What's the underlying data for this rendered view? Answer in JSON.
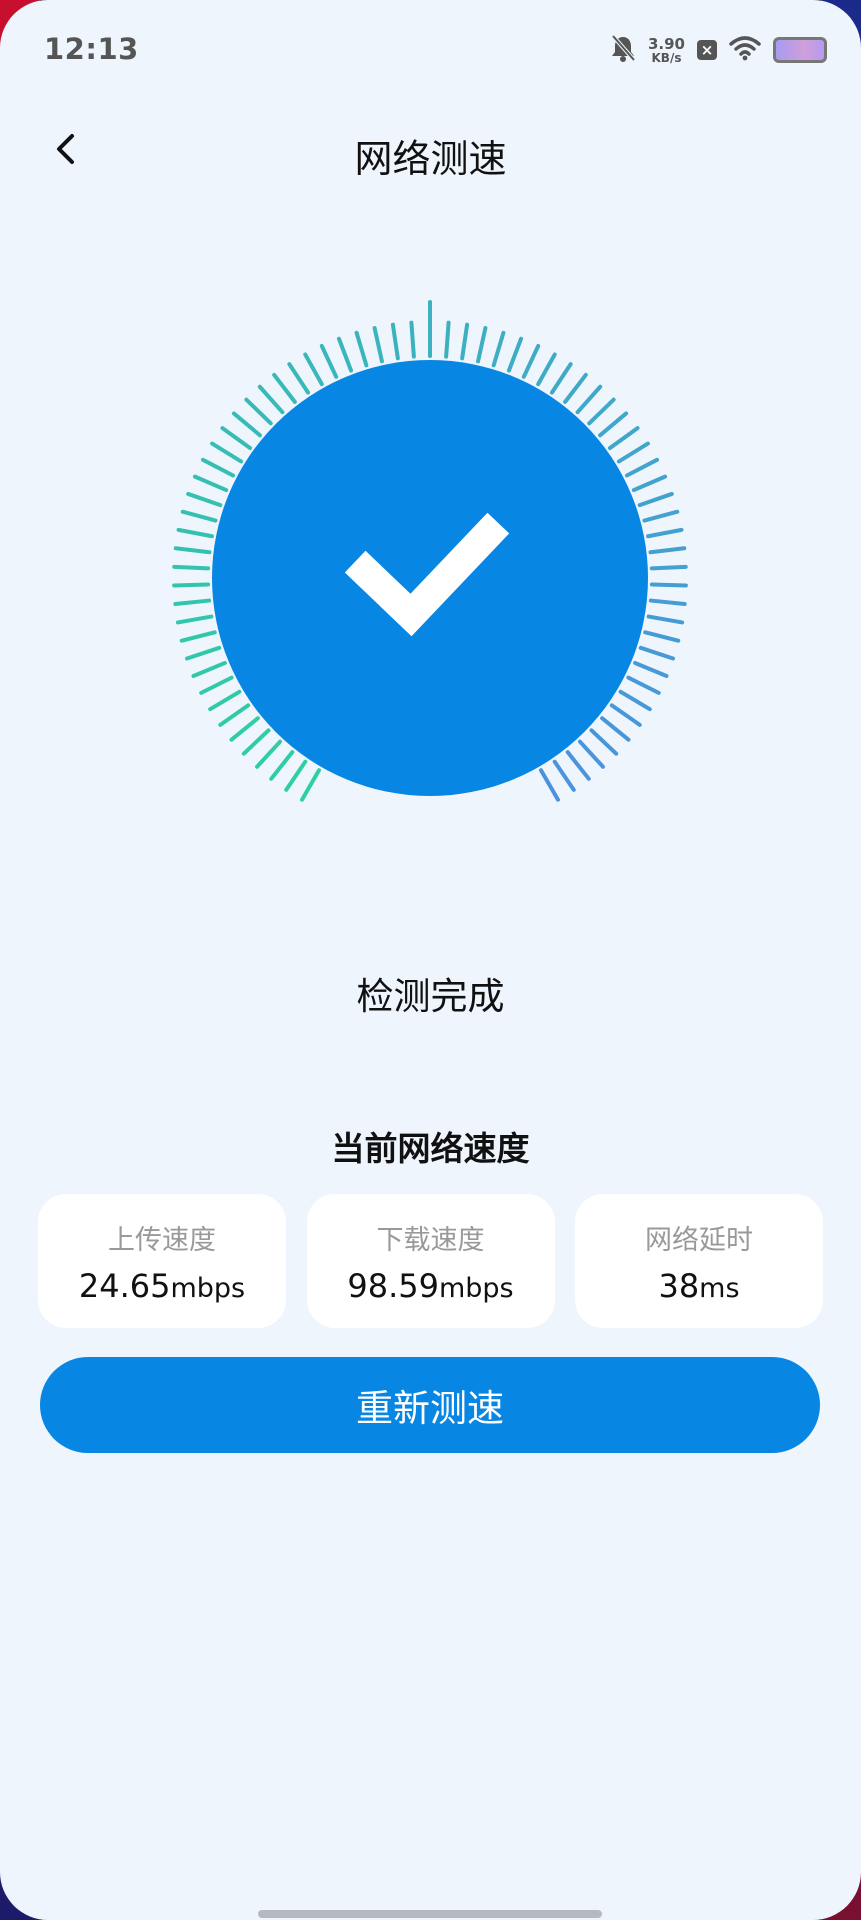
{
  "status_bar": {
    "time": "12:13",
    "net_speed_value": "3.90",
    "net_speed_unit": "KB/s",
    "badge": "×"
  },
  "header": {
    "title": "网络测速"
  },
  "gauge": {
    "state": "complete",
    "progress": 1.0,
    "colors": {
      "circle": "#0786e3",
      "tick_start": "#2dd0a2",
      "tick_end": "#4a92de"
    }
  },
  "result": {
    "status": "检测完成",
    "section_title": "当前网络速度",
    "stats": [
      {
        "label": "上传速度",
        "value": "24.65",
        "unit": "mbps"
      },
      {
        "label": "下载速度",
        "value": "98.59",
        "unit": "mbps"
      },
      {
        "label": "网络延时",
        "value": "38",
        "unit": "ms"
      }
    ]
  },
  "actions": {
    "retest_label": "重新测速"
  },
  "colors": {
    "background": "#eef5fd",
    "accent": "#0786e3"
  }
}
